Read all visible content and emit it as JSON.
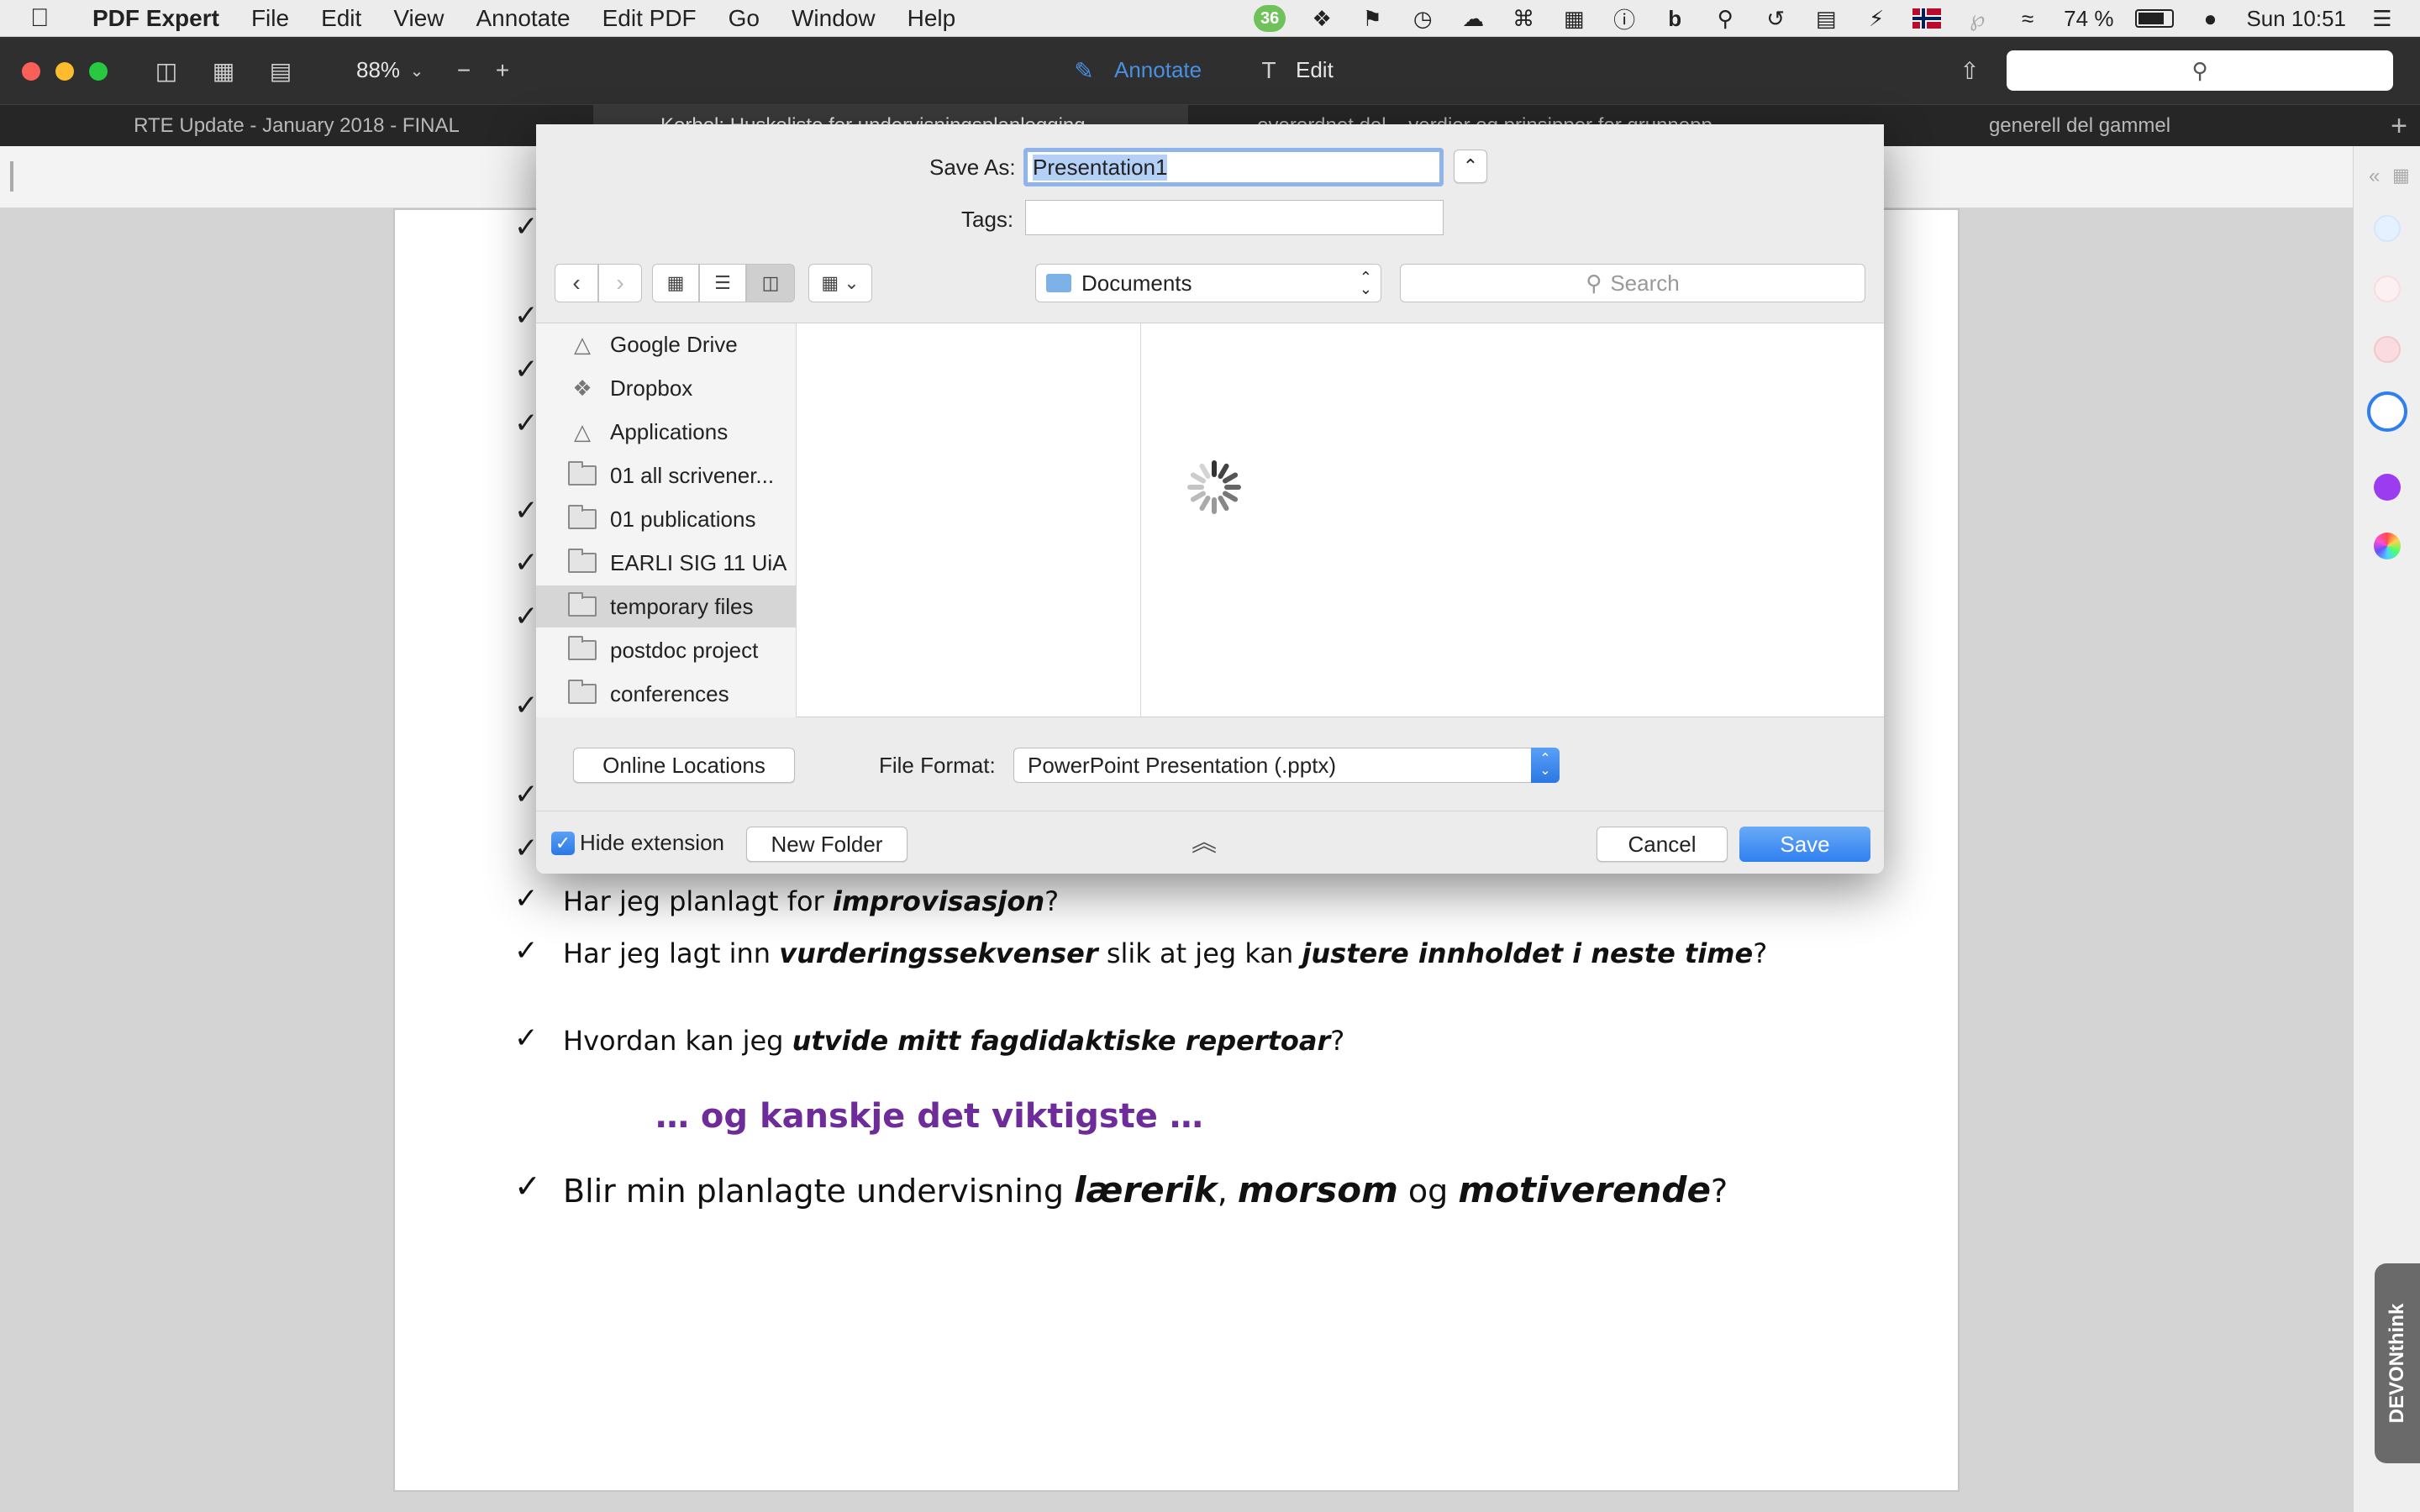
{
  "menubar": {
    "app_name": "PDF Expert",
    "menus": [
      "File",
      "Edit",
      "View",
      "Annotate",
      "Edit PDF",
      "Go",
      "Window",
      "Help"
    ],
    "badge_count": "36",
    "battery": "74 %",
    "clock": "Sun 10:51"
  },
  "toolbar": {
    "zoom": "88%",
    "annotate_label": "Annotate",
    "edit_label": "Edit"
  },
  "tabs": [
    "RTE Update - January 2018 - FINAL",
    "Korbol: Huskeliste for undervisningsplanlegging",
    "overordnet del – verdier og prinsipper for grunnopp",
    "generell del gammel"
  ],
  "document": {
    "lines": [
      {
        "parts": [
          {
            "t": "Har jeg planlagt for ",
            "b": false
          },
          {
            "t": "improvisasjon",
            "b": true
          },
          {
            "t": "?",
            "b": false
          }
        ]
      },
      {
        "parts": [
          {
            "t": "Har jeg lagt inn ",
            "b": false
          },
          {
            "t": "vurderingssekvenser",
            "b": true
          },
          {
            "t": " slik at jeg kan ",
            "b": false
          },
          {
            "t": "justere innholdet i neste time",
            "b": true
          },
          {
            "t": "?",
            "b": false
          }
        ]
      },
      {
        "parts": [
          {
            "t": "Hvordan kan jeg ",
            "b": false
          },
          {
            "t": "utvide mitt fagdidaktiske repertoar",
            "b": true
          },
          {
            "t": "?",
            "b": false
          }
        ]
      }
    ],
    "heading": "… og kanskje det viktigste …",
    "final_line": [
      {
        "t": "Blir min planlagte undervisning ",
        "b": false
      },
      {
        "t": "lærerik",
        "b": true
      },
      {
        "t": ", ",
        "b": false
      },
      {
        "t": "morsom",
        "b": true
      },
      {
        "t": " og ",
        "b": false
      },
      {
        "t": "motiverende",
        "b": true
      },
      {
        "t": "?",
        "b": false
      }
    ],
    "heading_color": "#6e2b9a"
  },
  "dialog": {
    "save_as_label": "Save As:",
    "save_as_value": "Presentation1",
    "tags_label": "Tags:",
    "location": "Documents",
    "search_placeholder": "Search",
    "sidebar": [
      {
        "label": "Google Drive",
        "icon": "google-drive-icon"
      },
      {
        "label": "Dropbox",
        "icon": "dropbox-icon"
      },
      {
        "label": "Applications",
        "icon": "applications-icon"
      },
      {
        "label": "01 all scrivener...",
        "icon": "folder-icon"
      },
      {
        "label": "01 publications",
        "icon": "folder-icon"
      },
      {
        "label": "EARLI SIG 11 UiA",
        "icon": "folder-icon"
      },
      {
        "label": "temporary files",
        "icon": "folder-icon"
      },
      {
        "label": "postdoc project",
        "icon": "folder-icon"
      },
      {
        "label": "conferences",
        "icon": "folder-icon"
      }
    ],
    "online_locations": "Online Locations",
    "file_format_label": "File Format:",
    "file_format_value": "PowerPoint Presentation (.pptx)",
    "hide_extension": "Hide extension",
    "new_folder": "New Folder",
    "cancel": "Cancel",
    "save": "Save"
  },
  "sidebar_right": {
    "devonthink": "DEVONthink"
  },
  "colors": {
    "accent": "#2f7ff0",
    "annotate_blue": "#4a90e2",
    "purple_dot": "#9b3cf0"
  }
}
